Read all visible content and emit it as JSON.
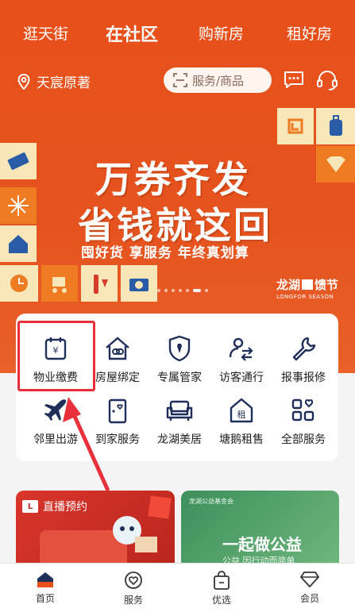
{
  "top_tabs": [
    "逛天街",
    "在社区",
    "购新房",
    "租好房"
  ],
  "location": "天宸原著",
  "search": {
    "placeholder": "服务/商品"
  },
  "banner": {
    "title_line1": "万券齐发",
    "title_line2": "省钱就这回",
    "subtitle": "囤好货  享服务  年终真划算",
    "logo_cn": "龙湖",
    "logo_cn2": "馈节",
    "logo_en": "LONGFOR SEASON"
  },
  "services": [
    {
      "label": "物业缴费",
      "icon": "property-fee-icon"
    },
    {
      "label": "房屋绑定",
      "icon": "house-link-icon"
    },
    {
      "label": "专属管家",
      "icon": "butler-icon"
    },
    {
      "label": "访客通行",
      "icon": "visitor-icon"
    },
    {
      "label": "报事报修",
      "icon": "repair-icon"
    },
    {
      "label": "邻里出游",
      "icon": "travel-icon"
    },
    {
      "label": "到家服务",
      "icon": "home-service-icon"
    },
    {
      "label": "龙湖美居",
      "icon": "sofa-icon"
    },
    {
      "label": "塘鹅租售",
      "icon": "rent-icon"
    },
    {
      "label": "全部服务",
      "icon": "all-services-icon"
    }
  ],
  "promo_left": {
    "tag": "直播预约"
  },
  "promo_right": {
    "header": "龙湖公益基金会",
    "title": "一起做公益",
    "subtitle": "公益   因行动而简单"
  },
  "bottom_nav": [
    {
      "label": "首页",
      "icon": "home-icon",
      "active": true
    },
    {
      "label": "服务",
      "icon": "service-heart-icon",
      "active": false
    },
    {
      "label": "优选",
      "icon": "shopping-bag-icon",
      "active": false
    },
    {
      "label": "会员",
      "icon": "diamond-icon",
      "active": false
    }
  ],
  "colors": {
    "brand": "#e8501a",
    "icon_navy": "#1f2f5a",
    "highlight": "#e8303a"
  }
}
